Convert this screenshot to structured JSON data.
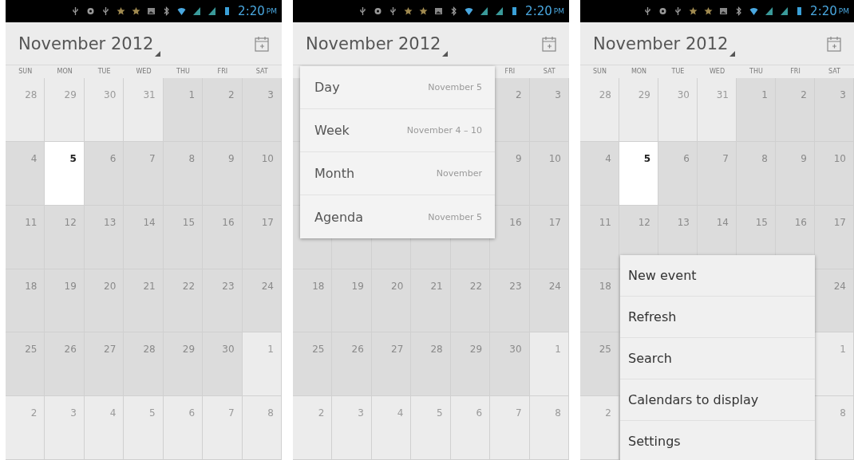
{
  "screens": [
    {
      "status_bar": {
        "time": "2:20",
        "am_pm": "PM"
      },
      "title": "November 2012",
      "weekdays": [
        "SUN",
        "MON",
        "TUE",
        "WED",
        "THU",
        "FRI",
        "SAT"
      ],
      "weeks": [
        [
          {
            "day": "28",
            "in_month": false,
            "today": false
          },
          {
            "day": "29",
            "in_month": false,
            "today": false
          },
          {
            "day": "30",
            "in_month": false,
            "today": false
          },
          {
            "day": "31",
            "in_month": false,
            "today": false
          },
          {
            "day": "1",
            "in_month": true,
            "today": false
          },
          {
            "day": "2",
            "in_month": true,
            "today": false
          },
          {
            "day": "3",
            "in_month": true,
            "today": false
          }
        ],
        [
          {
            "day": "4",
            "in_month": true,
            "today": false
          },
          {
            "day": "5",
            "in_month": true,
            "today": true
          },
          {
            "day": "6",
            "in_month": true,
            "today": false
          },
          {
            "day": "7",
            "in_month": true,
            "today": false
          },
          {
            "day": "8",
            "in_month": true,
            "today": false
          },
          {
            "day": "9",
            "in_month": true,
            "today": false
          },
          {
            "day": "10",
            "in_month": true,
            "today": false
          }
        ],
        [
          {
            "day": "11",
            "in_month": true,
            "today": false
          },
          {
            "day": "12",
            "in_month": true,
            "today": false
          },
          {
            "day": "13",
            "in_month": true,
            "today": false
          },
          {
            "day": "14",
            "in_month": true,
            "today": false
          },
          {
            "day": "15",
            "in_month": true,
            "today": false
          },
          {
            "day": "16",
            "in_month": true,
            "today": false
          },
          {
            "day": "17",
            "in_month": true,
            "today": false
          }
        ],
        [
          {
            "day": "18",
            "in_month": true,
            "today": false
          },
          {
            "day": "19",
            "in_month": true,
            "today": false
          },
          {
            "day": "20",
            "in_month": true,
            "today": false
          },
          {
            "day": "21",
            "in_month": true,
            "today": false
          },
          {
            "day": "22",
            "in_month": true,
            "today": false
          },
          {
            "day": "23",
            "in_month": true,
            "today": false
          },
          {
            "day": "24",
            "in_month": true,
            "today": false
          }
        ],
        [
          {
            "day": "25",
            "in_month": true,
            "today": false
          },
          {
            "day": "26",
            "in_month": true,
            "today": false
          },
          {
            "day": "27",
            "in_month": true,
            "today": false
          },
          {
            "day": "28",
            "in_month": true,
            "today": false
          },
          {
            "day": "29",
            "in_month": true,
            "today": false
          },
          {
            "day": "30",
            "in_month": true,
            "today": false
          },
          {
            "day": "1",
            "in_month": false,
            "today": false
          }
        ],
        [
          {
            "day": "2",
            "in_month": false,
            "today": false
          },
          {
            "day": "3",
            "in_month": false,
            "today": false
          },
          {
            "day": "4",
            "in_month": false,
            "today": false
          },
          {
            "day": "5",
            "in_month": false,
            "today": false
          },
          {
            "day": "6",
            "in_month": false,
            "today": false
          },
          {
            "day": "7",
            "in_month": false,
            "today": false
          },
          {
            "day": "8",
            "in_month": false,
            "today": false
          }
        ]
      ]
    },
    {
      "status_bar": {
        "time": "2:20",
        "am_pm": "PM"
      },
      "title": "November 2012",
      "weekdays": [
        "FRI",
        "SAT"
      ],
      "weeks": [
        [
          {
            "day": "2",
            "in_month": true,
            "today": false
          },
          {
            "day": "3",
            "in_month": true,
            "today": false
          }
        ],
        [
          {
            "day": "9",
            "in_month": true,
            "today": false
          },
          {
            "day": "10",
            "in_month": true,
            "today": false
          }
        ],
        [
          {
            "day": "16",
            "in_month": true,
            "today": false
          },
          {
            "day": "17",
            "in_month": true,
            "today": false
          }
        ],
        [
          {
            "day": "18",
            "in_month": true,
            "today": false
          },
          {
            "day": "19",
            "in_month": true,
            "today": false
          },
          {
            "day": "20",
            "in_month": true,
            "today": false
          },
          {
            "day": "21",
            "in_month": true,
            "today": false
          },
          {
            "day": "22",
            "in_month": true,
            "today": false
          },
          {
            "day": "23",
            "in_month": true,
            "today": false
          },
          {
            "day": "24",
            "in_month": true,
            "today": false
          }
        ],
        [
          {
            "day": "25",
            "in_month": true,
            "today": false
          },
          {
            "day": "26",
            "in_month": true,
            "today": false
          },
          {
            "day": "27",
            "in_month": true,
            "today": false
          },
          {
            "day": "28",
            "in_month": true,
            "today": false
          },
          {
            "day": "29",
            "in_month": true,
            "today": false
          },
          {
            "day": "30",
            "in_month": true,
            "today": false
          },
          {
            "day": "1",
            "in_month": false,
            "today": false
          }
        ],
        [
          {
            "day": "2",
            "in_month": false,
            "today": false
          },
          {
            "day": "3",
            "in_month": false,
            "today": false
          },
          {
            "day": "4",
            "in_month": false,
            "today": false
          },
          {
            "day": "5",
            "in_month": false,
            "today": false
          },
          {
            "day": "6",
            "in_month": false,
            "today": false
          },
          {
            "day": "7",
            "in_month": false,
            "today": false
          },
          {
            "day": "8",
            "in_month": false,
            "today": false
          }
        ]
      ],
      "view_menu": [
        {
          "label": "Day",
          "range": "November 5"
        },
        {
          "label": "Week",
          "range": "November 4 – 10"
        },
        {
          "label": "Month",
          "range": "November"
        },
        {
          "label": "Agenda",
          "range": "November 5"
        }
      ]
    },
    {
      "status_bar": {
        "time": "2:20",
        "am_pm": "PM"
      },
      "title": "November 2012",
      "weekdays": [
        "SUN",
        "MON",
        "TUE",
        "WED",
        "THU",
        "FRI",
        "SAT"
      ],
      "weeks": [
        [
          {
            "day": "28",
            "in_month": false,
            "today": false
          },
          {
            "day": "29",
            "in_month": false,
            "today": false
          },
          {
            "day": "30",
            "in_month": false,
            "today": false
          },
          {
            "day": "31",
            "in_month": false,
            "today": false
          },
          {
            "day": "1",
            "in_month": true,
            "today": false
          },
          {
            "day": "2",
            "in_month": true,
            "today": false
          },
          {
            "day": "3",
            "in_month": true,
            "today": false
          }
        ],
        [
          {
            "day": "4",
            "in_month": true,
            "today": false
          },
          {
            "day": "5",
            "in_month": true,
            "today": true
          },
          {
            "day": "6",
            "in_month": true,
            "today": false
          },
          {
            "day": "7",
            "in_month": true,
            "today": false
          },
          {
            "day": "8",
            "in_month": true,
            "today": false
          },
          {
            "day": "9",
            "in_month": true,
            "today": false
          },
          {
            "day": "10",
            "in_month": true,
            "today": false
          }
        ],
        [
          {
            "day": "11",
            "in_month": true,
            "today": false
          },
          {
            "day": "12",
            "in_month": true,
            "today": false
          },
          {
            "day": "13",
            "in_month": true,
            "today": false
          },
          {
            "day": "14",
            "in_month": true,
            "today": false
          },
          {
            "day": "15",
            "in_month": true,
            "today": false
          },
          {
            "day": "16",
            "in_month": true,
            "today": false
          },
          {
            "day": "17",
            "in_month": true,
            "today": false
          }
        ],
        [
          {
            "day": "18",
            "in_month": true,
            "today": false
          },
          {
            "day": "24",
            "in_month": true,
            "today": false
          }
        ],
        [
          {
            "day": "25",
            "in_month": true,
            "today": false
          },
          {
            "day": "1",
            "in_month": false,
            "today": false
          }
        ],
        [
          {
            "day": "2",
            "in_month": false,
            "today": false
          },
          {
            "day": "8",
            "in_month": false,
            "today": false
          }
        ]
      ],
      "options_menu": [
        "New event",
        "Refresh",
        "Search",
        "Calendars to display",
        "Settings"
      ]
    }
  ]
}
